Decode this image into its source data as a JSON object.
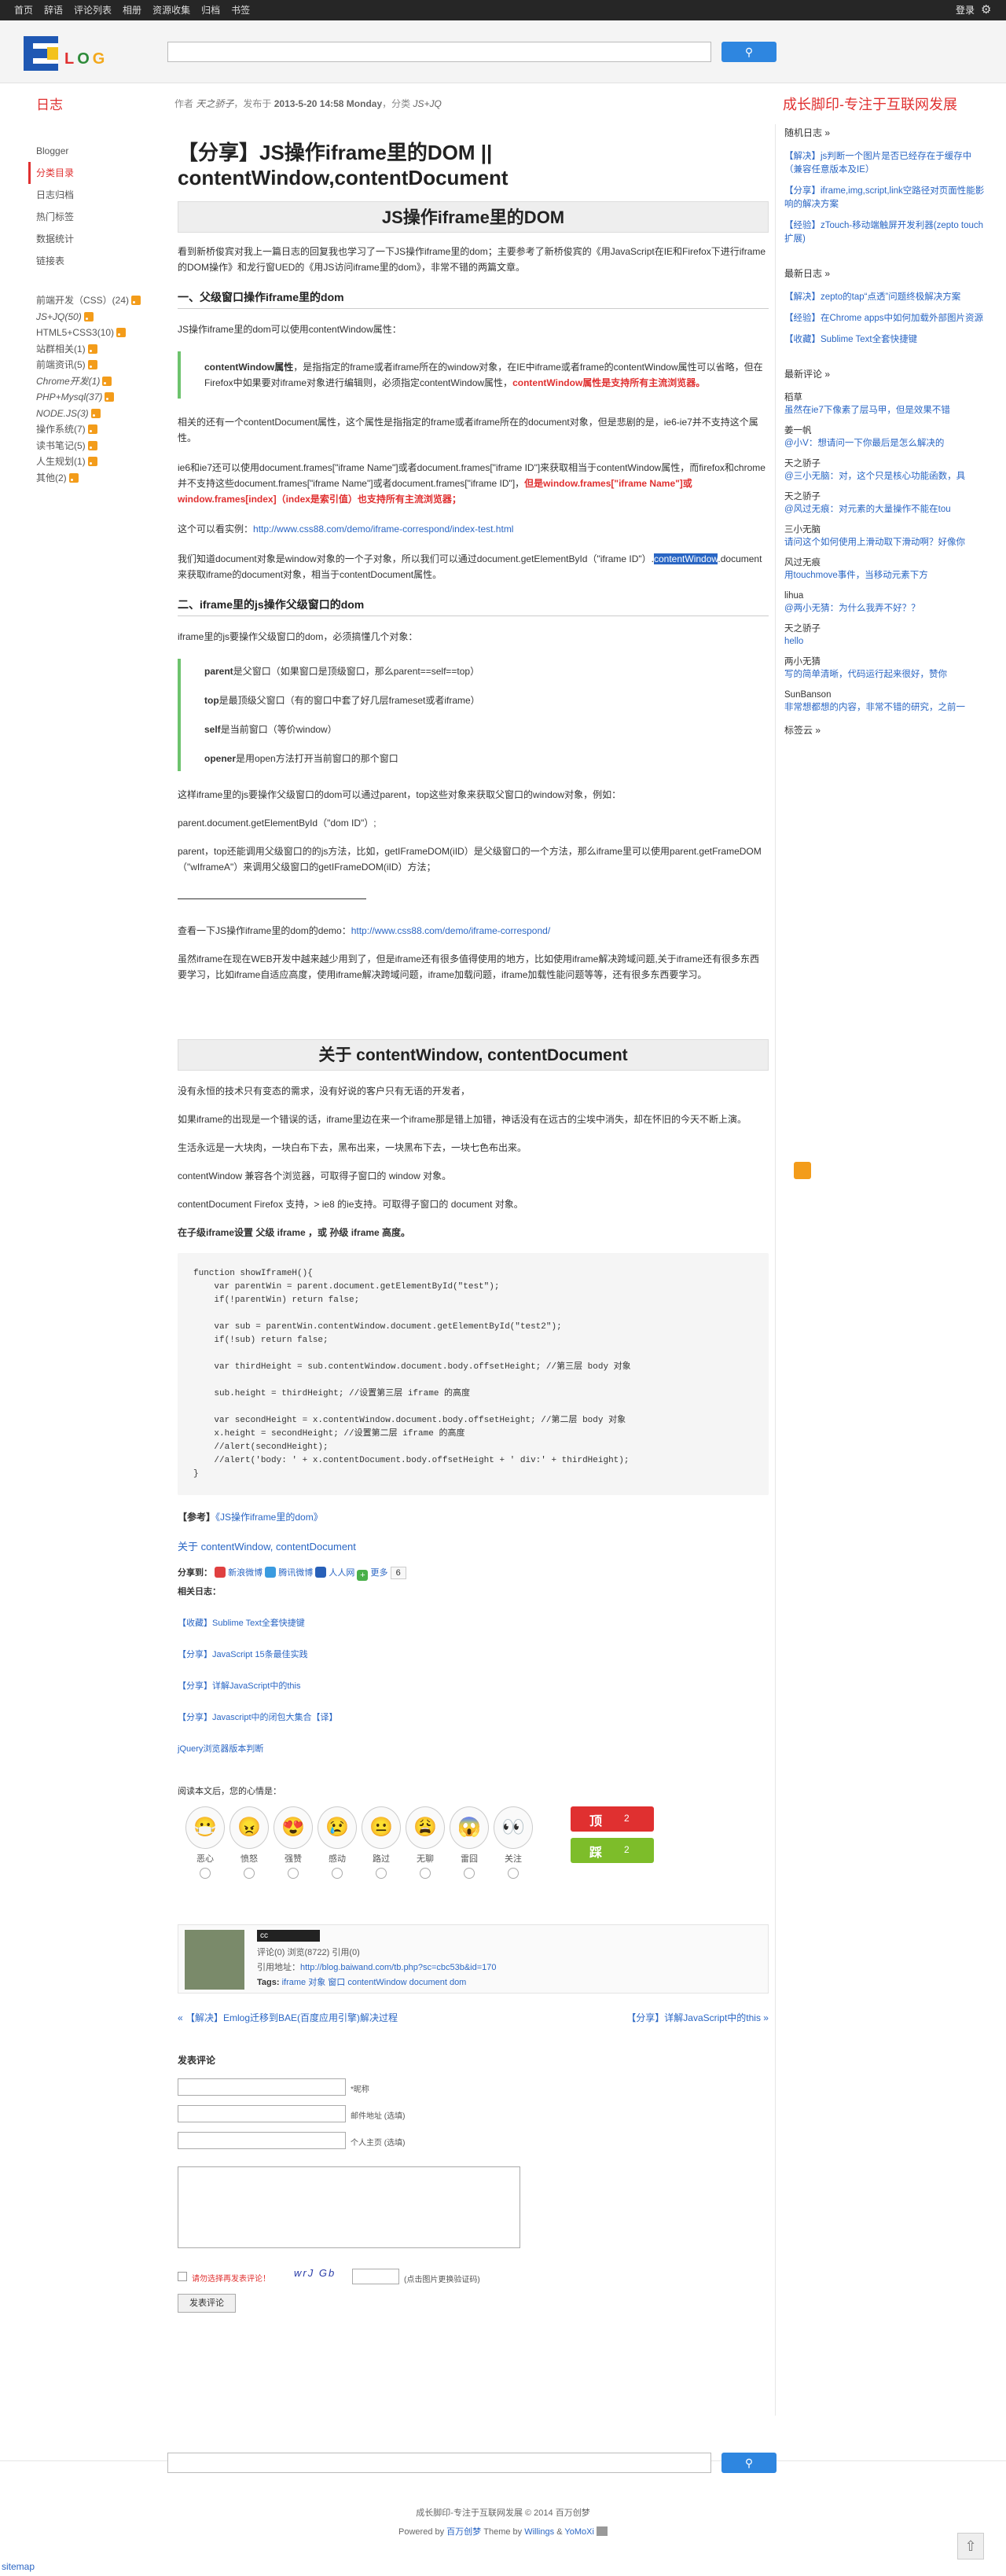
{
  "topbar": {
    "nav": [
      "首页",
      "辞语",
      "评论列表",
      "相册",
      "资源收集",
      "归档",
      "书签"
    ],
    "login": "登录"
  },
  "logo": {
    "text": "LOG"
  },
  "search": {
    "placeholder": "",
    "button": "搜索"
  },
  "subhead": {
    "home": "日志",
    "author_prefix": "作者",
    "author": "天之骄子",
    "published_prefix": "，发布于",
    "date": "2013-5-20 14:58 Monday",
    "category_prefix": "，分类",
    "category": "JS+JQ",
    "slogan": "成长脚印-专注于互联网发展"
  },
  "leftnav": {
    "items": [
      "Blogger",
      "分类目录",
      "日志归档",
      "热门标签",
      "数据统计",
      "链接表"
    ],
    "cats": [
      "前端开发（CSS）(24)",
      "JS+JQ(50)",
      "HTML5+CSS3(10)",
      "站群相关(1)",
      "前端资讯(5)",
      "Chrome开发(1)",
      "PHP+Mysql(37)",
      "NODE.JS(3)",
      "操作系统(7)",
      "读书笔记(5)",
      "人生规划(1)",
      "其他(2)"
    ]
  },
  "article": {
    "title": "【分享】JS操作iframe里的DOM || contentWindow,contentDocument",
    "h1": "JS操作iframe里的DOM",
    "p1": "看到新桥俊宾对我上一篇日志的回复我也学习了一下JS操作iframe里的dom；主要参考了新桥俊宾的《用JavaScript在IE和Firefox下进行iframe的DOM操作》和龙行窗UED的《用JS访问iframe里的dom》，非常不错的两篇文章。",
    "h2": "一、父级窗口操作iframe里的dom",
    "p2": "JS操作iframe里的dom可以使用contentWindow属性：",
    "q1a": "contentWindow属性",
    "q1b": "，是指指定的frame或者iframe所在的window对象，在IE中iframe或者frame的contentWindow属性可以省略，但在Firefox中如果要对iframe对象进行编辑则，必须指定contentWindow属性，",
    "q1c": "contentWindow属性是支持所有主流浏览器。",
    "p3": "相关的还有一个contentDocument属性，这个属性是指指定的frame或者iframe所在的document对象，但是悲剧的是，ie6-ie7并不支持这个属性。",
    "p4a": "ie6和ie7还可以使用document.frames[\"iframe Name\"]或者document.frames[\"iframe ID\"]来获取相当于contentWindow属性，而firefox和chrome并不支持这些document.frames[\"iframe Name\"]或者document.frames[\"iframe ID\"]，",
    "p4b": "但是window.frames[\"iframe Name\"]或window.frames[index]（index是索引值）也支持所有主流浏览器；",
    "p5a": "这个可以看实例：",
    "p5b": "http://www.css88.com/demo/iframe-correspond/index-test.html",
    "p6a": "我们知道document对象是window对象的一个子对象，所以我们可以通过document.getElementById（\"iframe ID\"）.",
    "p6b": "contentWindow",
    "p6c": ".document来获取iframe的document对象，相当于contentDocument属性。",
    "h3": "二、iframe里的js操作父级窗口的dom",
    "p7": "iframe里的js要操作父级窗口的dom，必须搞懂几个对象：",
    "q2": [
      [
        "parent",
        "是父窗口（如果窗口是顶级窗口，那么parent==self==top）"
      ],
      [
        "top",
        "是最顶级父窗口（有的窗口中套了好几层frameset或者iframe）"
      ],
      [
        "self",
        "是当前窗口（等价window）"
      ],
      [
        "opener",
        "是用open方法打开当前窗口的那个窗口"
      ]
    ],
    "p8": "这样iframe里的js要操作父级窗口的dom可以通过parent，top这些对象来获取父窗口的window对象，例如：",
    "p9": "parent.document.getElementById（\"dom ID\"）;",
    "p10": "parent，top还能调用父级窗口的的js方法，比如，getIFrameDOM(iID）是父级窗口的一个方法，那么iframe里可以使用parent.getFrameDOM（\"wIframeA\"）来调用父级窗口的getIFrameDOM(iID）方法；",
    "p11a": "查看一下JS操作iframe里的dom的demo：",
    "p11b": "http://www.css88.com/demo/iframe-correspond/",
    "p12": "虽然iframe在现在WEB开发中越来越少用到了，但是iframe还有很多值得使用的地方，比如使用iframe解决跨域问题,关于iframe还有很多东西要学习，比如iframe自适应高度，使用iframe解决跨域问题，iframe加载问题，iframe加载性能问题等等，还有很多东西要学习。",
    "h4": "关于 contentWindow, contentDocument",
    "p13": "没有永恒的技术只有变态的需求，没有好说的客户只有无语的开发者，",
    "p14": "如果iframe的出现是一个错误的话，iframe里边在来一个iframe那是错上加错，神话没有在远古的尘埃中消失，却在怀旧的今天不断上演。",
    "p15": "生活永远是一大块肉，一块白布下去，黑布出来，一块黑布下去，一块七色布出来。",
    "p16": "contentWindow 兼容各个浏览器，可取得子窗口的 window 对象。",
    "p17": "contentDocument Firefox 支持，> ie8 的ie支持。可取得子窗口的 document 对象。",
    "p18": "在子级iframe设置 父级 iframe ，或 孙级 iframe 高度。",
    "code": "function showIframeH(){\n    var parentWin = parent.document.getElementById(\"test\");\n    if(!parentWin) return false;\n\n    var sub = parentWin.contentWindow.document.getElementById(\"test2\");\n    if(!sub) return false;\n\n    var thirdHeight = sub.contentWindow.document.body.offsetHeight; //第三层 body 对象\n\n    sub.height = thirdHeight; //设置第三层 iframe 的高度\n\n    var secondHeight = x.contentWindow.document.body.offsetHeight; //第二层 body 对象\n    x.height = secondHeight; //设置第二层 iframe 的高度\n    //alert(secondHeight);\n    //alert('body: ' + x.contentDocument.body.offsetHeight + ' div:' + thirdHeight);\n}",
    "ref_label": "【参考】",
    "ref_link": "《JS操作iframe里的dom》",
    "ref_link2": "关于 contentWindow, contentDocument",
    "share_label": "分享到：",
    "share": [
      "新浪微博",
      "腾讯微博",
      "人人网",
      "更多"
    ],
    "share_count": "6",
    "related_title": "相关日志：",
    "related": [
      "【收藏】Sublime Text全套快捷键",
      "【分享】JavaScript 15条最佳实践",
      "【分享】详解JavaScript中的this",
      "【分享】Javascript中的闭包大集合【译】",
      "jQuery浏览器版本判断"
    ],
    "mood_title": "阅读本文后，您的心情是：",
    "moods": [
      "恶心",
      "愤怒",
      "强赞",
      "感动",
      "路过",
      "无聊",
      "雷囧",
      "关注"
    ],
    "vote_up": "顶",
    "vote_up_count": "2",
    "vote_down": "踩",
    "vote_down_count": "2",
    "info_comments": "评论(0) 浏览(8722) 引用(0)",
    "info_trackback_label": "引用地址：",
    "info_trackback": "http://blog.baiwand.com/tb.php?sc=cbc53b&id=170",
    "info_tags_label": "Tags:",
    "info_tags": "iframe 对象 窗口 contentWindow document dom",
    "prev": "« 【解决】Emlog迁移到BAE(百度应用引擎)解决过程",
    "next": "【分享】详解JavaScript中的this »",
    "cc": "cc"
  },
  "comment_form": {
    "title": "发表评论",
    "name_label": "*昵称",
    "email_label": "邮件地址 (选填)",
    "url_label": "个人主页 (选填)",
    "remember": "请勿选择再发表评论！",
    "captcha_hint": "(点击图片更换验证码)",
    "captcha": "wrJ Gb",
    "submit": "发表评论"
  },
  "sidebar": {
    "random_title": "随机日志 »",
    "random": [
      "【解决】js判断一个图片是否已经存在于缓存中（兼容任意版本及IE）",
      "【分享】iframe,img,script,link空路径对页面性能影响的解决方案",
      "【经验】zTouch-移动端触屏开发利器(zepto touch扩展)"
    ],
    "latest_title": "最新日志 »",
    "latest": [
      "【解决】zepto的tap“点透”问题终极解决方案",
      "【经验】在Chrome apps中如何加载外部图片资源",
      "【收藏】Sublime Text全套快捷键"
    ],
    "comments_title": "最新评论 »",
    "comments": [
      [
        "稻草",
        "虽然在ie7下像素了层马甲，但是效果不错"
      ],
      [
        "姜一帆",
        "@小V：想请问一下你最后是怎么解决的"
      ],
      [
        "天之骄子",
        "@三小无脑：对，这个只是核心功能函数，具"
      ],
      [
        "天之骄子",
        "@风过无痕：对元素的大量操作不能在tou"
      ],
      [
        "三小无脑",
        "请问这个如何使用上滑动取下滑动啊？好像你"
      ],
      [
        "风过无痕",
        "用touchmove事件，当移动元素下方"
      ],
      [
        "lihua",
        "@两小无猜：为什么我弄不好？？"
      ],
      [
        "天之骄子",
        "hello"
      ],
      [
        "两小无猜",
        "写的简单清晰，代码运行起来很好，赞你"
      ],
      [
        "SunBanson",
        "非常想都想的内容，非常不错的研究，之前一"
      ]
    ],
    "tags_title": "标签云 »"
  },
  "footer": {
    "copyright": "成长脚印-专注于互联网发展 © 2014 百万创梦",
    "powered_prefix": "Powered by",
    "powered": "百万创梦",
    "theme_prefix": "Theme by",
    "theme": "Willings",
    "theme_and": "&",
    "theme2": "YoMoXi",
    "sitemap": "sitemap"
  }
}
